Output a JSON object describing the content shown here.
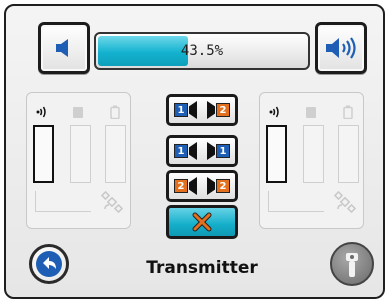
{
  "volume": {
    "percent_label": "43.5%",
    "level": 0.435,
    "decrease_icon": "speaker-quiet-icon",
    "increase_icon": "speaker-loud-icon"
  },
  "speakers": {
    "status_icons": [
      "signal-icon",
      "speaker-icon",
      "battery-icon",
      "satellite-icon"
    ]
  },
  "channel_buttons": [
    {
      "left": "1",
      "right": "2",
      "left_color": "blue",
      "right_color": "orange"
    },
    {
      "left": "1",
      "right": "1",
      "left_color": "blue",
      "right_color": "blue"
    },
    {
      "left": "2",
      "right": "2",
      "left_color": "orange",
      "right_color": "orange"
    }
  ],
  "mute_button": {
    "icon": "mute-x-icon"
  },
  "footer": {
    "title": "Transmitter",
    "back_icon": "back-arrow-icon",
    "transmitter_icon": "transmitter-icon"
  },
  "colors": {
    "accent": "#14aeca",
    "channel_blue": "#1e5fb5",
    "channel_orange": "#e3701f",
    "mute_x": "#e3701f"
  }
}
